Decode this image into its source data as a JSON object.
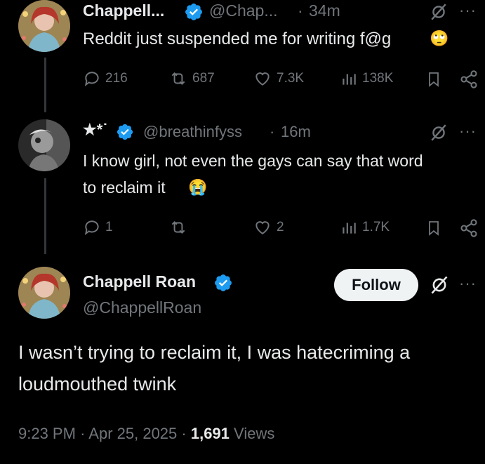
{
  "tweet1": {
    "name": "Chappell...",
    "handle": "@Chap...",
    "sep": "·",
    "time": "34m",
    "text": "Reddit just suspended me for writing f@g",
    "emoji": "🙄",
    "replies": "216",
    "retweets": "687",
    "likes": "7.3K",
    "views": "138K"
  },
  "tweet2": {
    "name": "★*˙",
    "handle": "@breathinfyss",
    "sep": "·",
    "time": "16m",
    "text_line1": "I know girl, not even the gays can say that word",
    "text_line2": "to reclaim it",
    "emoji": "😭",
    "replies": "1",
    "likes": "2",
    "views": "1.7K"
  },
  "main_tweet": {
    "name": "Chappell Roan",
    "handle": "@ChappellRoan",
    "follow_label": "Follow",
    "text_line1": "I wasn’t trying to reclaim it, I was hatecriming a",
    "text_line2": "loudmouthed twink",
    "time": "9:23 PM",
    "sep1": "·",
    "date": "Apr 25, 2025",
    "sep2": "·",
    "views_count": "1,691",
    "views_label": "Views"
  },
  "icons": {
    "more": "···"
  },
  "colors": {
    "background": "#000000",
    "text": "#e7e9ea",
    "muted": "#71767b",
    "verified": "#1d9bf0",
    "follow_bg": "#eff3f4"
  }
}
